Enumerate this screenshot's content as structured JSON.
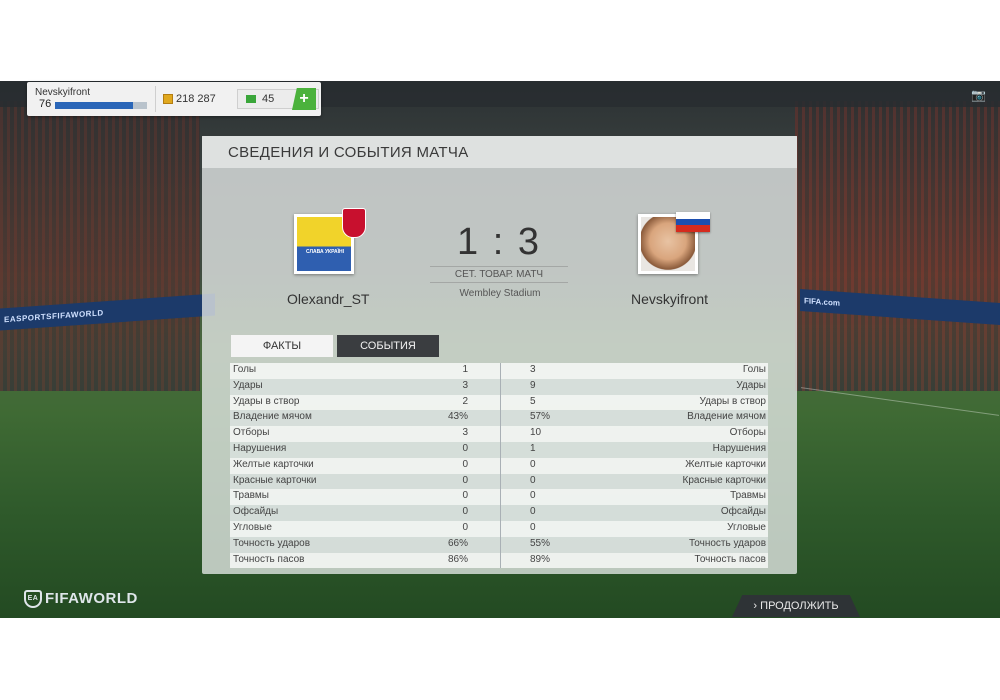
{
  "player": {
    "name": "Nevskyifront",
    "level": "76",
    "xp_fraction": 0.85
  },
  "currency": {
    "coins": "218 287",
    "points": "45",
    "plus_label": "+"
  },
  "panel": {
    "title": "СВЕДЕНИЯ И СОБЫТИЯ МАТЧА",
    "left_team": "Olexandr_ST",
    "right_team": "Nevskyifront",
    "score": "1 : 3",
    "match_type": "СЕТ. ТОВАР. МАТЧ",
    "stadium": "Wembley Stadium",
    "left_badge_text": "СЛАВА УКРАЇНІ",
    "tabs": [
      {
        "label": "ФАКТЫ"
      },
      {
        "label": "СОБЫТИЯ"
      }
    ]
  },
  "stats": [
    {
      "label": "Голы",
      "left": "1",
      "right": "3"
    },
    {
      "label": "Удары",
      "left": "3",
      "right": "9"
    },
    {
      "label": "Удары в створ",
      "left": "2",
      "right": "5"
    },
    {
      "label": "Владение мячом",
      "left": "43%",
      "right": "57%"
    },
    {
      "label": "Отборы",
      "left": "3",
      "right": "10"
    },
    {
      "label": "Нарушения",
      "left": "0",
      "right": "1"
    },
    {
      "label": "Желтые карточки",
      "left": "0",
      "right": "0"
    },
    {
      "label": "Красные карточки",
      "left": "0",
      "right": "0"
    },
    {
      "label": "Травмы",
      "left": "0",
      "right": "0"
    },
    {
      "label": "Офсайды",
      "left": "0",
      "right": "0"
    },
    {
      "label": "Угловые",
      "left": "0",
      "right": "0"
    },
    {
      "label": "Точность ударов",
      "left": "66%",
      "right": "55%"
    },
    {
      "label": "Точность пасов",
      "left": "86%",
      "right": "89%"
    }
  ],
  "footer": {
    "brand": "FIFAWORLD",
    "ea": "EA",
    "continue_label": "ПРОДОЛЖИТЬ"
  },
  "background": {
    "ad_left": "EASPORTSFIFAWORLD",
    "ad_right": "FIFA.com"
  },
  "colors": {
    "accent_green": "#4bb23c",
    "xp_blue": "#2a66b8",
    "dark_tab": "#3a3d40"
  },
  "icons": {
    "camera": "camera-icon",
    "coin": "coin-icon",
    "points": "fifa-points-icon",
    "continue": "chevron-right-icon"
  }
}
